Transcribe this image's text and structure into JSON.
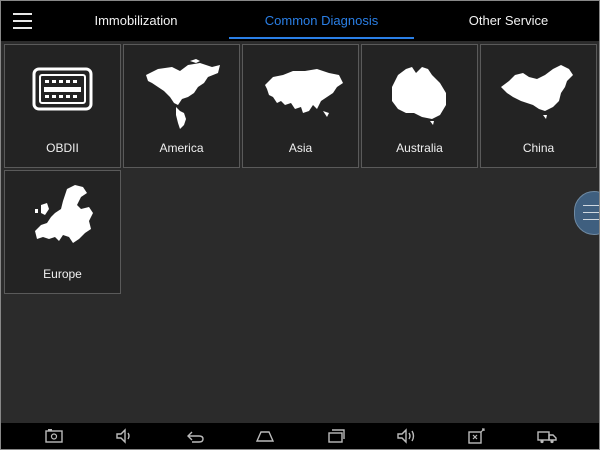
{
  "header": {
    "tabs": [
      {
        "label": "Immobilization",
        "active": false
      },
      {
        "label": "Common Diagnosis",
        "active": true
      },
      {
        "label": "Other Service",
        "active": false
      }
    ],
    "menu_icon": "hamburger-menu-icon"
  },
  "tiles": [
    {
      "label": "OBDII",
      "icon": "obd-connector-icon"
    },
    {
      "label": "America",
      "icon": "america-map-icon"
    },
    {
      "label": "Asia",
      "icon": "asia-map-icon"
    },
    {
      "label": "Australia",
      "icon": "australia-map-icon"
    },
    {
      "label": "China",
      "icon": "china-map-icon"
    },
    {
      "label": "Europe",
      "icon": "europe-map-icon"
    }
  ],
  "side_handle_icon": "side-drawer-handle-icon",
  "navbar": {
    "buttons": [
      "screenshot-icon",
      "volume-down-icon",
      "back-icon",
      "home-icon",
      "recent-apps-icon",
      "volume-up-icon",
      "vci-connection-icon",
      "truck-icon"
    ]
  },
  "colors": {
    "accent": "#2a7fe6",
    "background": "#2b2b2b",
    "tile": "#232323",
    "bar": "#000000"
  }
}
